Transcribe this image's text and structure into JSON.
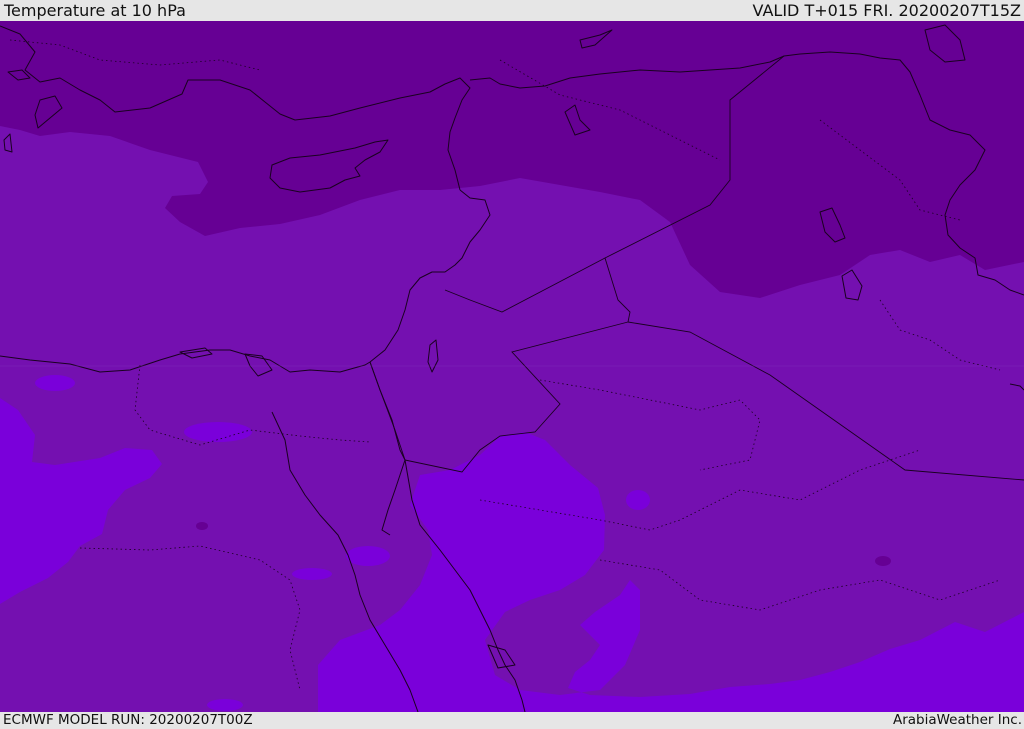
{
  "header": {
    "title": "Temperature at 10 hPa",
    "valid": "VALID T+015 FRI. 20200207T15Z"
  },
  "footer": {
    "model_run": "ECMWF MODEL RUN: 20200207T00Z",
    "credit": "ArabiaWeather Inc."
  },
  "colors": {
    "band_dark": "#660094",
    "band_mid": "#7410b0",
    "band_light": "#7a00da",
    "border": "#1a0020"
  }
}
